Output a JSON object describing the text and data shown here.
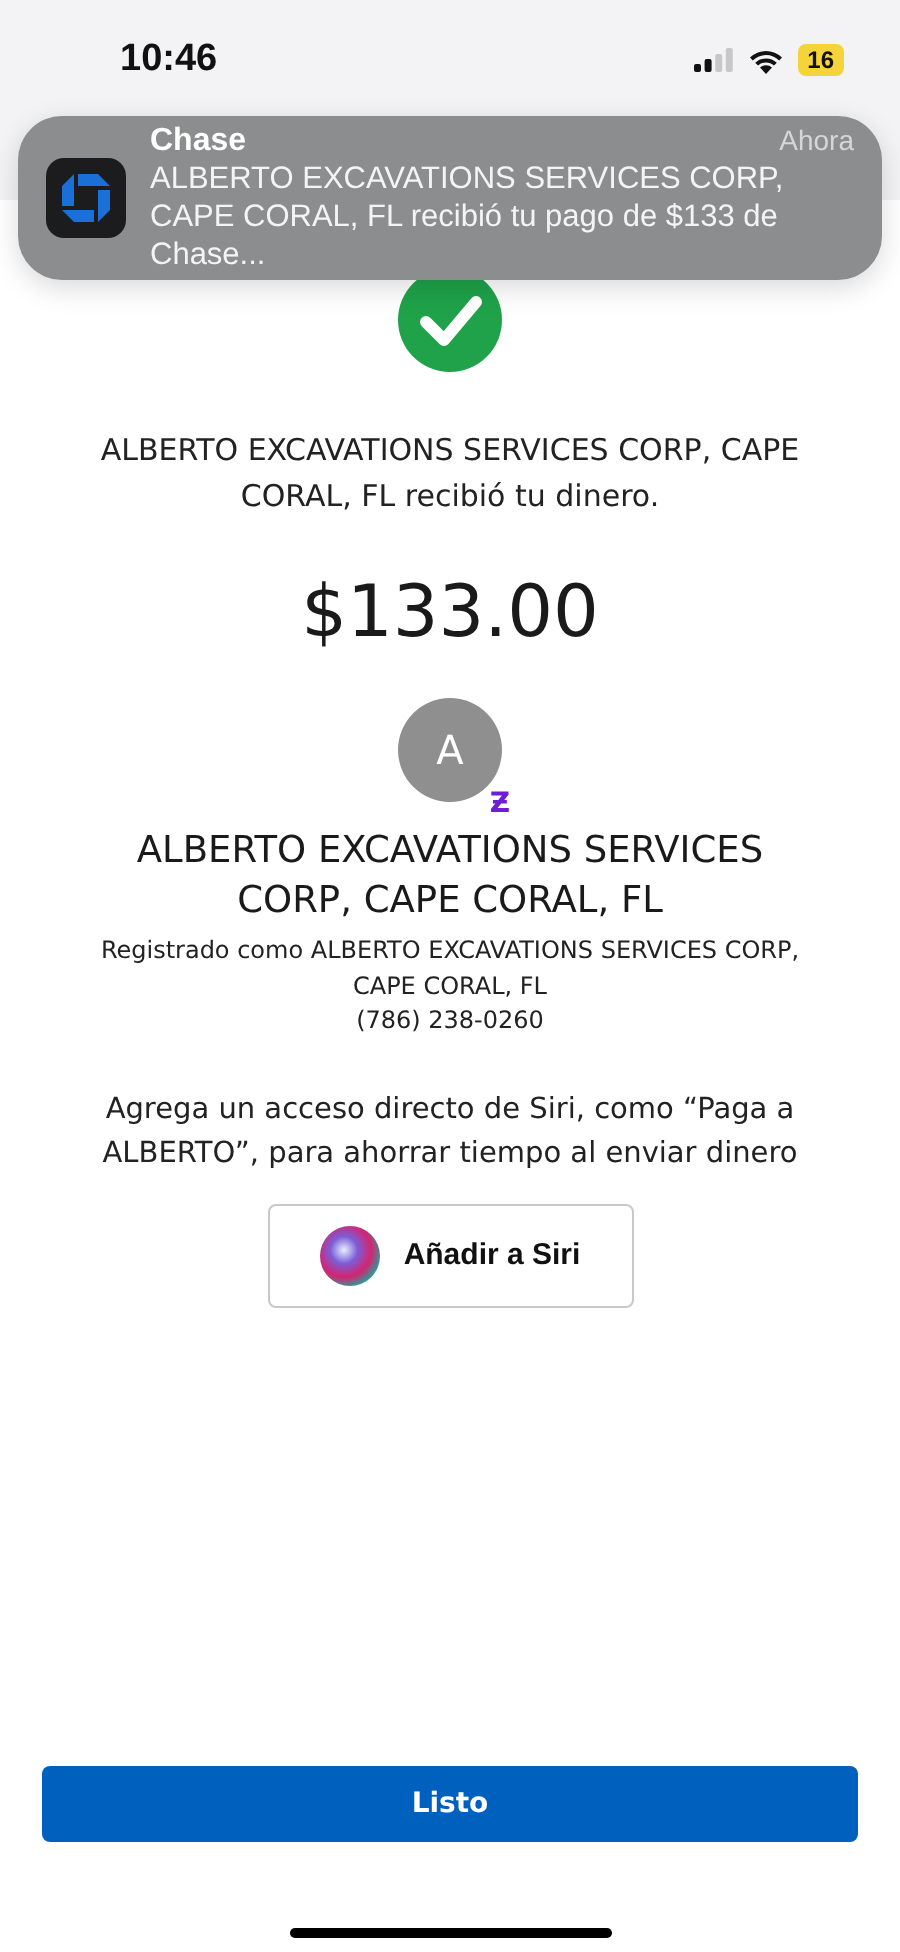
{
  "status_bar": {
    "time": "10:46",
    "battery": "16"
  },
  "notification": {
    "app": "Chase",
    "time": "Ahora",
    "message": "ALBERTO EXCAVATIONS SERVICES CORP, CAPE CORAL, FL recibió tu pago de $133 de Chase..."
  },
  "confirmation": {
    "message": "ALBERTO EXCAVATIONS SERVICES CORP, CAPE CORAL, FL recibió tu dinero.",
    "amount": "$133.00"
  },
  "recipient": {
    "initial": "A",
    "badge": "Ƶ",
    "name": "ALBERTO EXCAVATIONS SERVICES CORP, CAPE CORAL, FL",
    "registered": "Registrado como ALBERTO EXCAVATIONS SERVICES CORP, CAPE CORAL, FL",
    "phone": "(786) 238-0260"
  },
  "siri": {
    "hint": "Agrega un acceso directo de Siri, como “Paga a ALBERTO”, para ahorrar tiempo al enviar dinero",
    "button": "Añadir a Siri"
  },
  "done_button": "Listo"
}
